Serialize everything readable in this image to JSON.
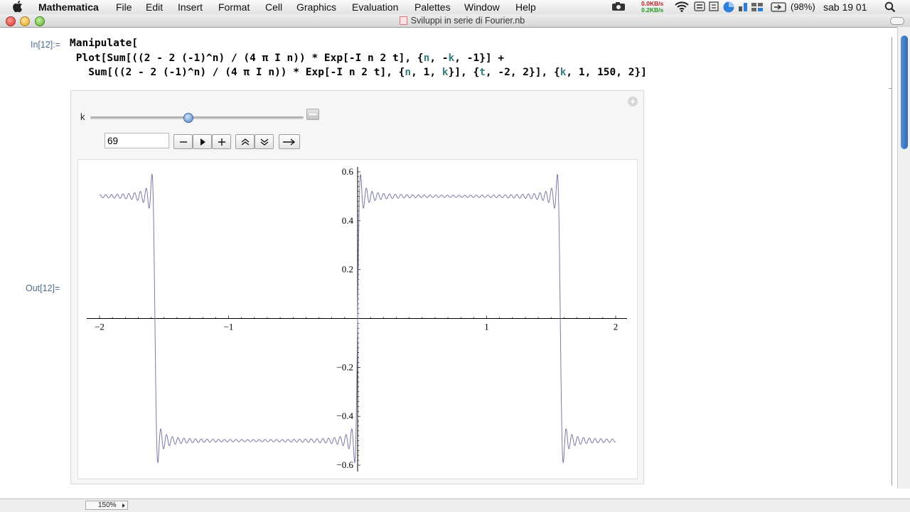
{
  "menubar": {
    "app_name": "Mathematica",
    "menus": [
      "File",
      "Edit",
      "Insert",
      "Format",
      "Cell",
      "Graphics",
      "Evaluation",
      "Window",
      "Help",
      "Palettes"
    ],
    "net_up": "0.0KB/s",
    "net_down": "0.2KB/s",
    "battery": "(98%)",
    "clock": "sab 19 01"
  },
  "window": {
    "title": "Sviluppi in serie di Fourier.nb"
  },
  "cells": {
    "in_label": "In[12]:=",
    "out_label": "Out[12]="
  },
  "code": {
    "head": "Manipulate[",
    "l2a": " Plot[Sum[((2 - 2 (-1)^n) / (4 π I n)) * Exp[-I n 2 t], {",
    "l2b": "n",
    "l2c": ", -",
    "l2d": "k",
    "l2e": ", -1}] +",
    "l3a": "   Sum[((2 - 2 (-1)^n) / (4 π I n)) * Exp[-I n 2 t], {",
    "l3b": "n",
    "l3c": ", 1, ",
    "l3d": "k",
    "l3e": "}], {",
    "l3f": "t",
    "l3g": ", -2, 2}], {",
    "l3h": "k",
    "l3i": ", 1, 150, 2}]"
  },
  "manipulate": {
    "slider_label": "k",
    "slider_fraction": 0.46,
    "value": "69"
  },
  "chart_data": {
    "type": "line",
    "xlim": [
      -2,
      2
    ],
    "ylim": [
      -0.6,
      0.6
    ],
    "x_ticks": [
      "-2",
      "-1",
      "1",
      "2"
    ],
    "y_ticks": [
      "0.6",
      "0.4",
      "0.2",
      "-0.2",
      "-0.4",
      "-0.6"
    ],
    "function": "sum over odd n from -k to k of ((2 - 2(-1)^n)/(4 π i n)) e^(-2 i n t)",
    "k": 69,
    "line_color": "#7a7aa6",
    "grid": false
  },
  "zoom": "150%"
}
